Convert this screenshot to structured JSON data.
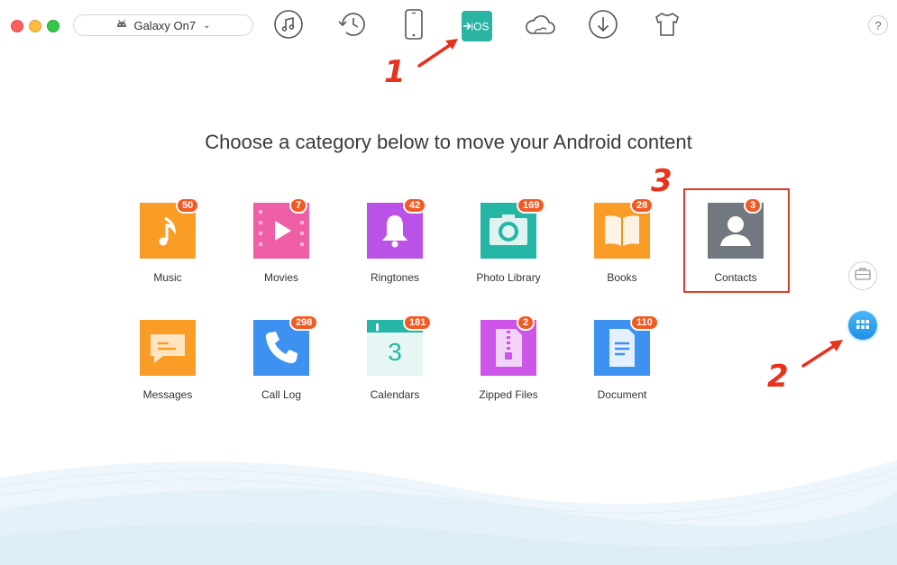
{
  "window": {
    "device_name": "Galaxy On7",
    "help_label": "?"
  },
  "toolbar": {
    "tools": [
      {
        "icon": "music-note-icon"
      },
      {
        "icon": "history-icon"
      },
      {
        "icon": "phone-icon"
      },
      {
        "icon": "to-ios-icon",
        "label": "iOS",
        "active": true
      },
      {
        "icon": "cloud-icon"
      },
      {
        "icon": "download-icon"
      },
      {
        "icon": "tshirt-icon"
      }
    ]
  },
  "main": {
    "heading": "Choose a category below to move your Android content",
    "categories": [
      {
        "label": "Music",
        "count": "50",
        "color": "#f7941d"
      },
      {
        "label": "Movies",
        "count": "7",
        "color": "#ec5ba4"
      },
      {
        "label": "Ringtones",
        "count": "42",
        "color": "#b84de6"
      },
      {
        "label": "Photo Library",
        "count": "169",
        "color": "#23b5a4"
      },
      {
        "label": "Books",
        "count": "28",
        "color": "#f7941d"
      },
      {
        "label": "Contacts",
        "count": "3",
        "color": "#6e757c"
      },
      {
        "label": "Messages",
        "count": "",
        "color": "#f7941d"
      },
      {
        "label": "Call Log",
        "count": "298",
        "color": "#3a8ff0"
      },
      {
        "label": "Calendars",
        "count": "181",
        "color": "#23b5a4",
        "day": "3"
      },
      {
        "label": "Zipped Files",
        "count": "2",
        "color": "#c94fe6"
      },
      {
        "label": "Document",
        "count": "110",
        "color": "#3a8ff0"
      }
    ]
  },
  "annotations": {
    "step1": "1",
    "step2": "2",
    "step3": "3",
    "color": "#e8321e"
  },
  "sidebar": {
    "buttons": [
      {
        "icon": "toolkit-icon"
      },
      {
        "icon": "category-grid-icon"
      }
    ]
  }
}
